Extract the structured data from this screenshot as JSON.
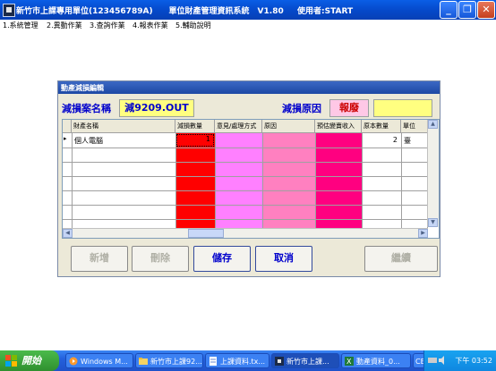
{
  "window": {
    "title": "新竹市上課專用單位(123456789A)　　單位財產管理資訊系統　V1.80",
    "user": "使用者:START"
  },
  "menu": [
    {
      "label": "1.系統管理"
    },
    {
      "label": "2.異動作業"
    },
    {
      "label": "3.查詢作業"
    },
    {
      "label": "4.報表作業"
    },
    {
      "label": "5.輔助說明"
    }
  ],
  "dialog": {
    "title": "動產減損編輯",
    "case_label": "減損案名稱",
    "case_value": "減9209.OUT",
    "reason_label": "減損原因",
    "reason_value": "報廢",
    "reason_extra": ""
  },
  "grid": {
    "columns": [
      "財產名稱",
      "減損數量",
      "意見/處理方式",
      "原因",
      "預估變賣收入",
      "原本數量",
      "單位"
    ],
    "rows": [
      {
        "name": "個人電腦",
        "qty": "1",
        "opinion": "",
        "reason": "",
        "income": "",
        "orig_qty": "2",
        "unit": "臺"
      }
    ]
  },
  "buttons": {
    "add": "新增",
    "delete": "刪除",
    "save": "儲存",
    "cancel": "取消",
    "continue": "繼續"
  },
  "taskbar": {
    "start": "開始",
    "tasks": [
      {
        "label": "Windows M..."
      },
      {
        "label": "新竹市上課92..."
      },
      {
        "label": "上課資料.tx..."
      },
      {
        "label": "新竹市上課..."
      },
      {
        "label": "動產資料_0..."
      },
      {
        "label": "CE"
      }
    ],
    "clock": "下午 03:52"
  },
  "colors": {
    "qty_column": "#ff0000",
    "opinion_column": "#ff80ff",
    "reason_column": "#ff80c0",
    "income_column": "#ff0080",
    "titlebar": "#0548c9"
  }
}
